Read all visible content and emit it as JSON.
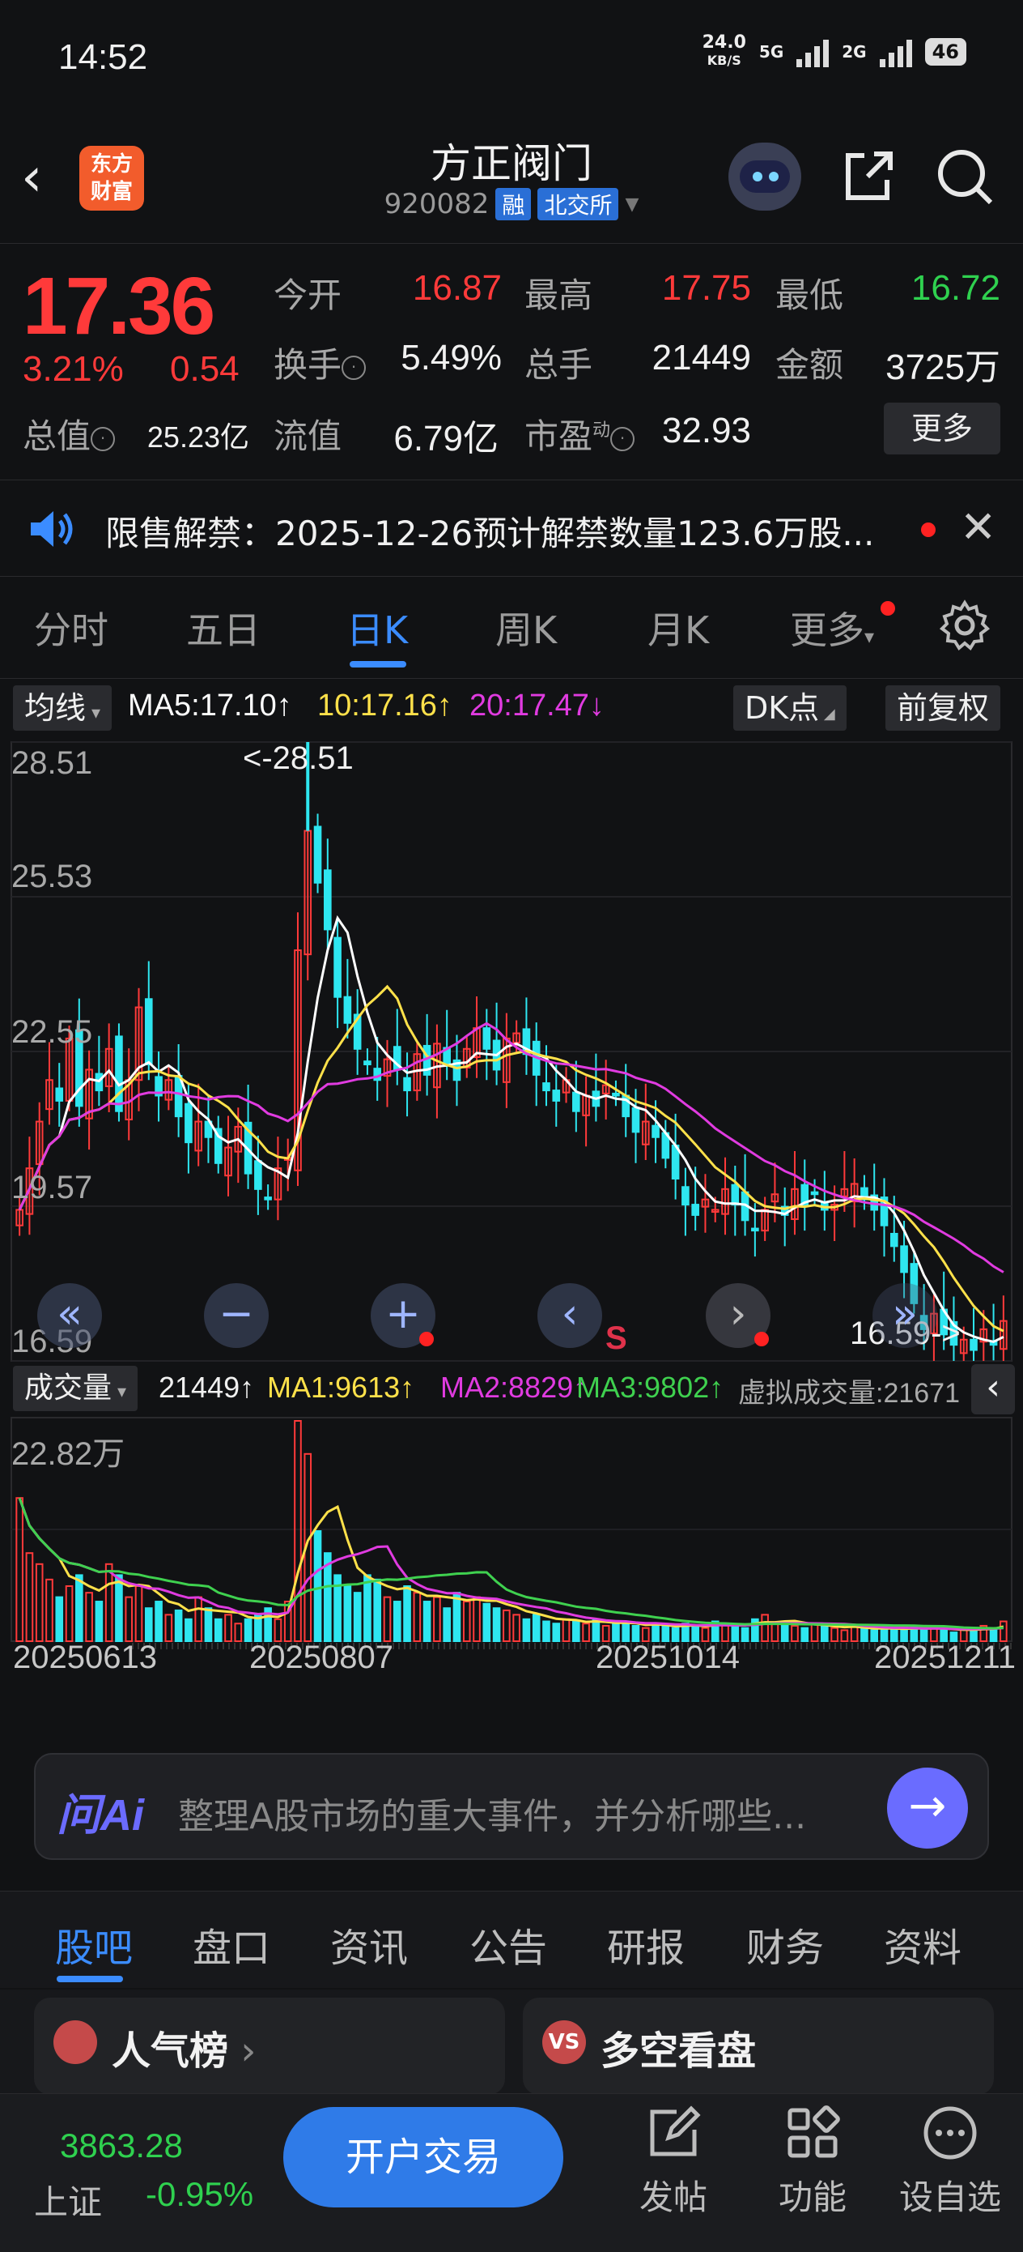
{
  "status": {
    "time": "14:52",
    "netspeed_value": "24.0",
    "netspeed_unit": "KB/S",
    "net1": "5G",
    "net2": "2G",
    "battery": "46"
  },
  "header": {
    "logo_text_1": "东方",
    "logo_text_2": "财富",
    "title": "方正阀门",
    "code": "920082",
    "badge1": "融",
    "badge2": "北交所"
  },
  "quote": {
    "price": "17.36",
    "pct": "3.21%",
    "change": "0.54",
    "open_label": "今开",
    "open": "16.87",
    "high_label": "最高",
    "high": "17.75",
    "low_label": "最低",
    "low": "16.72",
    "turnover_label": "换手",
    "turnover": "5.49%",
    "volume_label": "总手",
    "volume": "21449",
    "amount_label": "金额",
    "amount": "3725万",
    "mktcap_label": "总值",
    "mktcap": "25.23亿",
    "float_label": "流值",
    "float": "6.79亿",
    "pe_label": "市盈",
    "pe_sup": "动",
    "pe": "32.93",
    "more": "更多"
  },
  "notice": {
    "text": "限售解禁：2025-12-26预计解禁数量123.6万股..."
  },
  "tabs": [
    "分时",
    "五日",
    "日K",
    "周K",
    "月K",
    "更多"
  ],
  "ma": {
    "selector": "均线",
    "ma5": "MA5:17.10↑",
    "ma10": "10:17.16↑",
    "ma20": "20:17.47↓",
    "dk": "DK点",
    "adj": "前复权"
  },
  "price_axis": [
    "28.51",
    "25.53",
    "22.55",
    "19.57",
    "16.59"
  ],
  "annot": {
    "max": "<-28.51",
    "min": "16.59->",
    "s_marker": "S"
  },
  "vol": {
    "selector": "成交量",
    "v": "21449↑",
    "ma1": "MA1:9613↑",
    "ma2": "MA2:8829↑",
    "ma3": "MA3:9802↑",
    "virt": "虚拟成交量:21671",
    "axis_top": "22.82万"
  },
  "dates": [
    "20250613",
    "20250807",
    "20251014",
    "20251211"
  ],
  "ai": {
    "logo": "问Ai",
    "placeholder": "整理A股市场的重大事件，并分析哪些..."
  },
  "bottom_tabs": [
    "股吧",
    "盘口",
    "资讯",
    "公告",
    "研报",
    "财务",
    "资料"
  ],
  "cards": [
    {
      "icon": "",
      "title": "人气榜"
    },
    {
      "icon": "VS",
      "title": "多空看盘"
    }
  ],
  "footer": {
    "index_value": "3863.28",
    "index_name": "上证",
    "index_pct": "-0.95%",
    "trade": "开户交易",
    "post": "发帖",
    "func": "功能",
    "watch": "设自选"
  },
  "colors": {
    "up": "#ff3a3a",
    "down": "#2fd14f",
    "accent": "#3b8cff",
    "candle_down": "#2ee6f0",
    "ma5": "#ffffff",
    "ma10": "#ffe14a",
    "ma20": "#e03be0",
    "vol_ma3": "#3fd14f"
  },
  "chart_data": {
    "type": "candlestick",
    "price_range": [
      16.59,
      28.51
    ],
    "price_ticks": [
      28.51,
      25.53,
      22.55,
      19.57,
      16.59
    ],
    "max_label": 28.51,
    "min_label": 16.59,
    "date_ticks": [
      "20250613",
      "20250807",
      "20251014",
      "20251211"
    ],
    "close_series": [
      19.5,
      20.3,
      21.2,
      22.0,
      21.6,
      22.8,
      21.5,
      22.2,
      21.8,
      22.6,
      21.4,
      22.0,
      23.4,
      22.3,
      21.7,
      22.0,
      21.3,
      20.8,
      21.2,
      20.9,
      20.4,
      20.7,
      21.1,
      20.2,
      19.9,
      19.7,
      20.3,
      20.5,
      24.5,
      26.8,
      25.8,
      24.9,
      23.6,
      23.1,
      22.6,
      22.3,
      22.0,
      22.4,
      22.2,
      21.8,
      22.5,
      22.1,
      22.7,
      22.3,
      22.0,
      22.6,
      23.0,
      22.6,
      22.2,
      22.8,
      22.9,
      22.5,
      22.1,
      21.8,
      21.6,
      22.0,
      21.4,
      21.7,
      21.5,
      21.9,
      21.7,
      21.3,
      21.0,
      21.2,
      20.9,
      20.5,
      20.1,
      19.6,
      19.4,
      19.7,
      19.5,
      19.9,
      19.6,
      19.3,
      19.1,
      19.5,
      19.8,
      19.4,
      19.9,
      19.6,
      19.8,
      19.5,
      19.6,
      19.9,
      20.0,
      19.7,
      19.5,
      19.2,
      18.8,
      18.3,
      17.7,
      17.2,
      17.5,
      17.1,
      16.9,
      17.0,
      16.8,
      17.2,
      16.9,
      17.36
    ],
    "volume_max_label": "22.82万",
    "volume_series": [
      0.65,
      0.4,
      0.35,
      0.28,
      0.2,
      0.25,
      0.3,
      0.22,
      0.18,
      0.35,
      0.3,
      0.2,
      0.25,
      0.15,
      0.18,
      0.12,
      0.14,
      0.1,
      0.2,
      0.15,
      0.1,
      0.12,
      0.08,
      0.1,
      0.12,
      0.15,
      0.1,
      0.18,
      1.0,
      0.85,
      0.5,
      0.4,
      0.3,
      0.25,
      0.22,
      0.3,
      0.28,
      0.2,
      0.18,
      0.25,
      0.22,
      0.18,
      0.2,
      0.15,
      0.22,
      0.18,
      0.2,
      0.17,
      0.15,
      0.14,
      0.12,
      0.1,
      0.12,
      0.09,
      0.08,
      0.1,
      0.09,
      0.08,
      0.1,
      0.07,
      0.08,
      0.09,
      0.07,
      0.06,
      0.08,
      0.07,
      0.06,
      0.08,
      0.07,
      0.06,
      0.09,
      0.08,
      0.07,
      0.06,
      0.1,
      0.12,
      0.08,
      0.09,
      0.07,
      0.06,
      0.08,
      0.07,
      0.06,
      0.05,
      0.07,
      0.06,
      0.05,
      0.06,
      0.05,
      0.06,
      0.07,
      0.05,
      0.06,
      0.05,
      0.04,
      0.06,
      0.05,
      0.07,
      0.06,
      0.09
    ]
  }
}
